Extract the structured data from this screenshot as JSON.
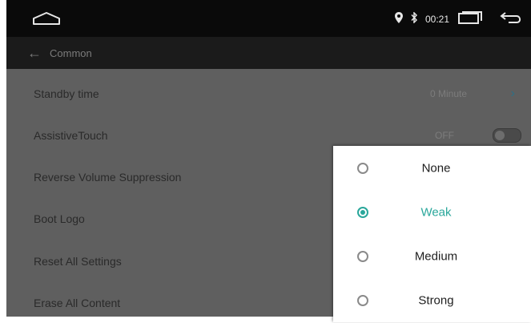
{
  "statusbar": {
    "time": "00:21"
  },
  "titlebar": {
    "title": "Common"
  },
  "rows": [
    {
      "label": "Standby time",
      "value": "0 Minute"
    },
    {
      "label": "AssistiveTouch",
      "value": "OFF"
    },
    {
      "label": "Reverse Volume Suppression"
    },
    {
      "label": "Boot Logo"
    },
    {
      "label": "Reset All Settings"
    },
    {
      "label": "Erase All Content"
    }
  ],
  "popup": {
    "selected": "Weak",
    "options": [
      "None",
      "Weak",
      "Medium",
      "Strong"
    ]
  },
  "colors": {
    "accent": "#2aa79b",
    "chevron": "#2e6f86"
  }
}
